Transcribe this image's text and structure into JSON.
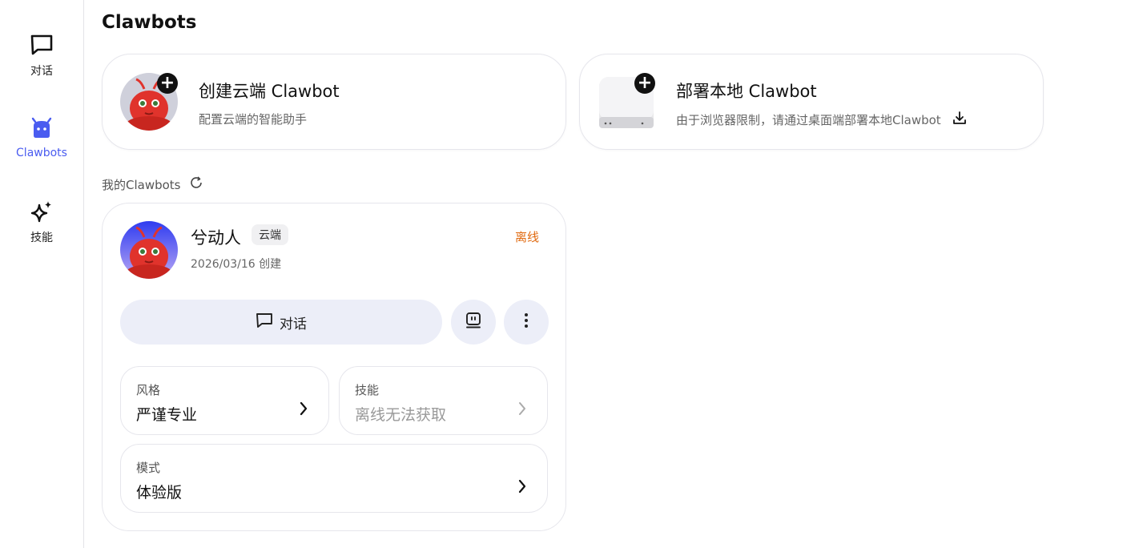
{
  "sidebar": {
    "items": [
      {
        "label": "对话",
        "icon": "chat-bubble-icon",
        "active": false
      },
      {
        "label": "Clawbots",
        "icon": "robot-icon",
        "active": true
      },
      {
        "label": "技能",
        "icon": "sparkle-icon",
        "active": false
      }
    ]
  },
  "page": {
    "title": "Clawbots"
  },
  "create_cards": [
    {
      "title": "创建云端 Clawbot",
      "subtitle": "配置云端的智能助手",
      "icon": "lobster-avatar"
    },
    {
      "title": "部署本地 Clawbot",
      "subtitle": "由于浏览器限制，请通过桌面端部署本地Clawbot",
      "icon": "mini-pc-image",
      "action_icon": "download-icon"
    }
  ],
  "my_bots": {
    "label": "我的Clawbots",
    "bots": [
      {
        "name": "兮动人",
        "tag": "云端",
        "created": "2026/03/16 创建",
        "status": "离线",
        "chat_label": "对话",
        "settings": [
          {
            "key": "风格",
            "value": "严谨专业"
          },
          {
            "key": "技能",
            "value": "离线无法获取"
          },
          {
            "key": "模式",
            "value": "体验版"
          }
        ]
      }
    ]
  },
  "colors": {
    "accent": "#4a5cf0",
    "offline": "#e06a10",
    "button_bg": "#eceef8"
  }
}
